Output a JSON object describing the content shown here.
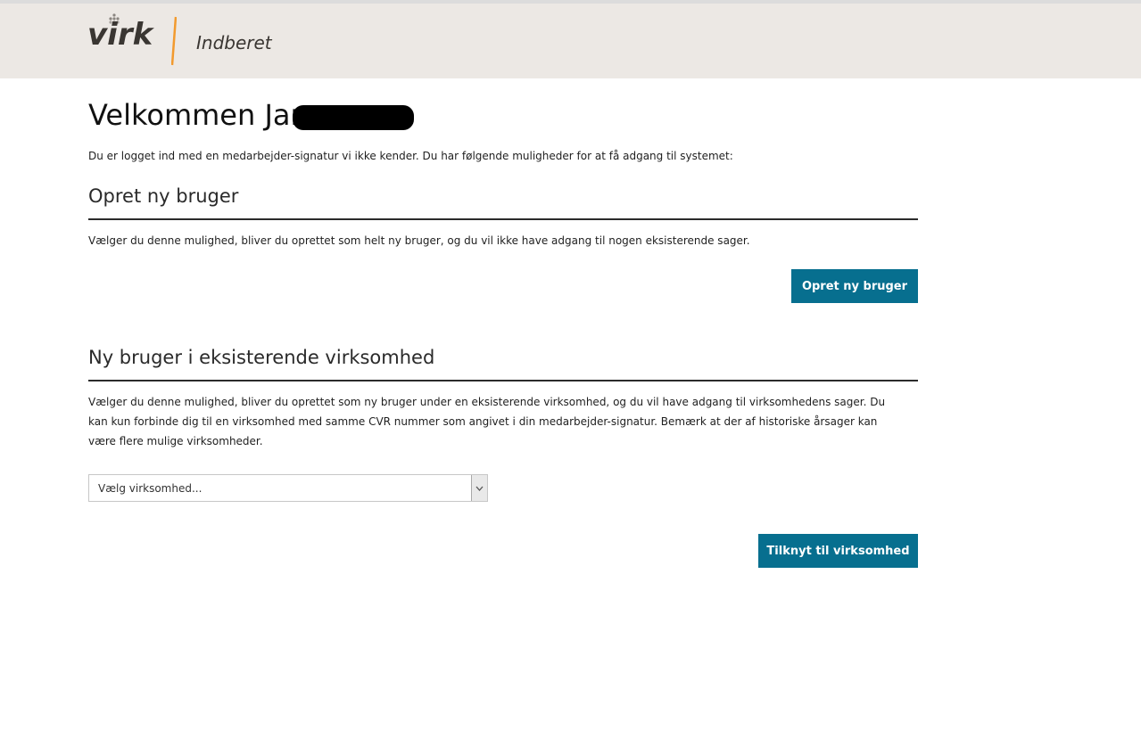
{
  "header": {
    "logo_text": "virk",
    "app_name": "Indberet",
    "colors": {
      "header_bg": "#ece8e4",
      "slash": "#f29a2e",
      "logo_text": "#3a3632"
    }
  },
  "page": {
    "title": "Velkommen Jan",
    "intro": "Du er logget ind med en medarbejder-signatur vi ikke kender. Du har følgende muligheder for at få adgang til systemet:"
  },
  "sections": {
    "new_user": {
      "title": "Opret ny bruger",
      "description": "Vælger du denne mulighed, bliver du oprettet som helt ny bruger, og du vil ikke have adgang til nogen eksisterende sager.",
      "button_label": "Opret ny bruger"
    },
    "existing_company": {
      "title": "Ny bruger i eksisterende virksomhed",
      "description": "Vælger du denne mulighed, bliver du oprettet som ny bruger under en eksisterende virksomhed, og du vil have adgang til virksomhedens sager. Du kan kun forbinde dig til en virksomhed med samme CVR nummer som angivet i din medarbejder-signatur. Bemærk at der af historiske årsager kan være flere mulige virksomheder.",
      "select_placeholder": "Vælg virksomhed...",
      "button_label": "Tilknyt til virksomhed"
    }
  },
  "theme": {
    "button_color": "#076f8f",
    "rule_color": "#2b2b2b"
  },
  "icons": {
    "dropdown": "chevron-down-icon"
  }
}
